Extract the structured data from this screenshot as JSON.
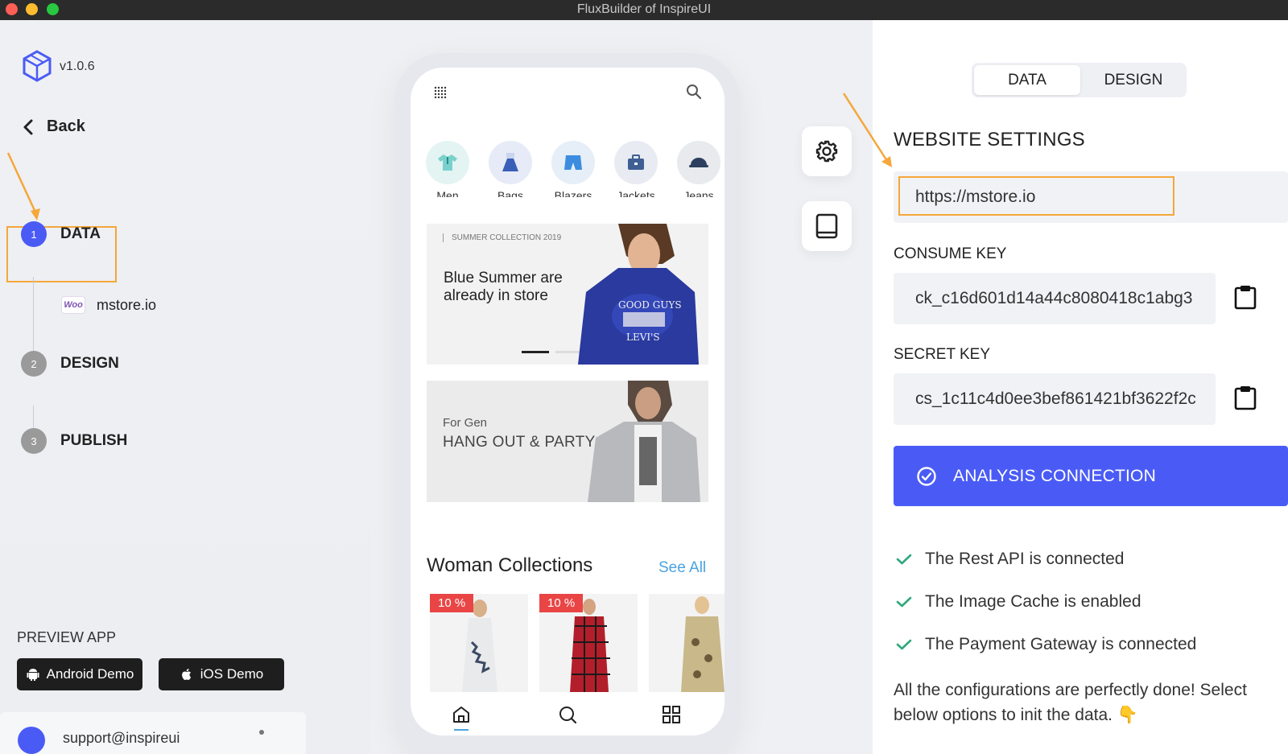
{
  "window": {
    "title": "FluxBuilder of InspireUI"
  },
  "sidebar": {
    "version": "v1.0.6",
    "back_label": "Back",
    "steps": [
      {
        "number": "1",
        "label": "DATA"
      },
      {
        "number": "2",
        "label": "DESIGN"
      },
      {
        "number": "3",
        "label": "PUBLISH"
      }
    ],
    "woo_badge": "Woo",
    "site_name": "mstore.io",
    "preview_label": "PREVIEW APP",
    "android_demo": "Android Demo",
    "ios_demo": "iOS Demo",
    "user_email": "support@inspireui"
  },
  "phone": {
    "categories": [
      "Men",
      "Bags",
      "Blazers",
      "Jackets",
      "Jeans"
    ],
    "banner1": {
      "tag": "SUMMER COLLECTION 2019",
      "headline": "Blue Summer are already in store"
    },
    "banner2": {
      "sub": "For Gen",
      "headline": "HANG OUT & PARTY"
    },
    "collection_title": "Woman Collections",
    "see_all": "See All",
    "discount_1": "10 %",
    "discount_2": "10 %"
  },
  "panel": {
    "tab_data": "DATA",
    "tab_design": "DESIGN",
    "title": "WEBSITE SETTINGS",
    "url_value": "https://mstore.io",
    "consume_key_label": "CONSUME KEY",
    "consume_key_value": "ck_c16d601d14a44c8080418c1abg3",
    "secret_key_label": "SECRET KEY",
    "secret_key_value": "cs_1c11c4d0ee3bef861421bf3622f2c",
    "analysis_button": "ANALYSIS CONNECTION",
    "checks": [
      "The Rest API is connected",
      "The Image Cache is enabled",
      "The Payment Gateway is connected"
    ],
    "done_note": "All the configurations are perfectly done! Select below options to init the data. 👇"
  },
  "colors": {
    "accent": "#4a5bf5",
    "highlight": "#f5a73a",
    "check": "#2fa97c",
    "link": "#4aa3df"
  }
}
